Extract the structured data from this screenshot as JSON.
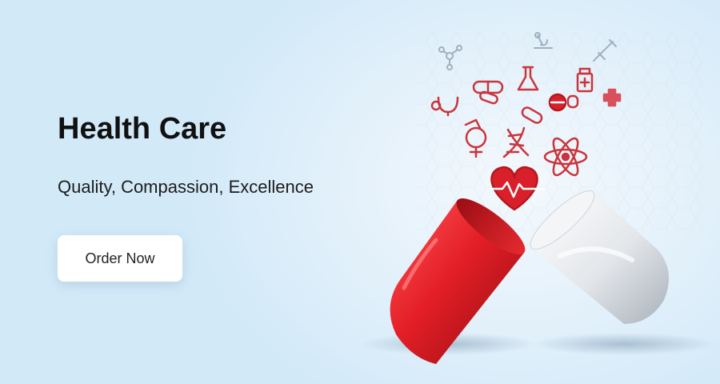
{
  "hero": {
    "title": "Health Care",
    "subtitle": "Quality, Compassion, Excellence",
    "cta_label": "Order Now"
  },
  "colors": {
    "brand_red": "#d9202a",
    "icon_red": "#c9353c",
    "background": "#d2e9f8",
    "button_bg": "#ffffff"
  },
  "icons": [
    "molecule-icon",
    "microscope-icon",
    "syringe-icon",
    "stethoscope-icon",
    "pill-icon",
    "flask-icon",
    "medicine-bottle-icon",
    "medical-cross-icon",
    "tablet-icon",
    "dna-icon",
    "atom-icon",
    "heartbeat-icon",
    "gender-symbol-icon"
  ]
}
